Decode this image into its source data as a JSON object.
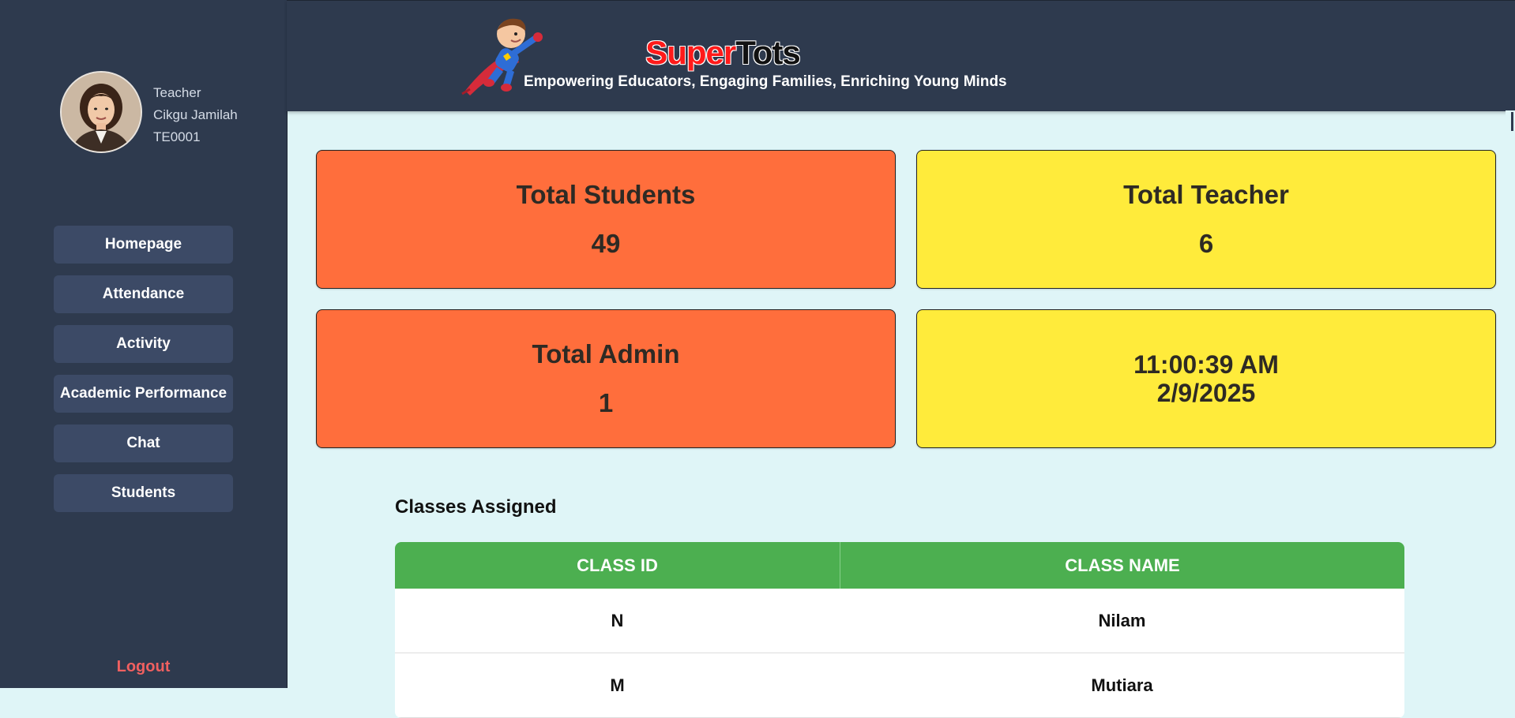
{
  "profile": {
    "role": "Teacher",
    "name": "Cikgu Jamilah",
    "id": "TE0001"
  },
  "nav": {
    "items": [
      {
        "label": "Homepage"
      },
      {
        "label": "Attendance"
      },
      {
        "label": "Activity"
      },
      {
        "label": "Academic Performance"
      },
      {
        "label": "Chat"
      },
      {
        "label": "Students"
      }
    ],
    "logout": "Logout"
  },
  "header": {
    "brand_part1": "Super",
    "brand_part2": "Tots",
    "tagline": "Empowering Educators, Engaging Families, Enriching Young Minds"
  },
  "stats": {
    "students": {
      "title": "Total Students",
      "value": "49"
    },
    "teachers": {
      "title": "Total Teacher",
      "value": "6"
    },
    "admins": {
      "title": "Total Admin",
      "value": "1"
    },
    "clock": {
      "time": "11:00:39 AM",
      "date": "2/9/2025"
    }
  },
  "classes": {
    "title": "Classes Assigned",
    "headers": [
      "CLASS ID",
      "CLASS NAME"
    ],
    "rows": [
      {
        "id": "N",
        "name": "Nilam"
      },
      {
        "id": "M",
        "name": "Mutiara"
      }
    ]
  },
  "colors": {
    "sidebar": "#2e3a4e",
    "nav_button": "#3c4a66",
    "card_orange": "#ff6e3c",
    "card_yellow": "#ffeb3b",
    "table_header": "#4caf50",
    "logout": "#f06060",
    "background": "#dff5f7"
  }
}
